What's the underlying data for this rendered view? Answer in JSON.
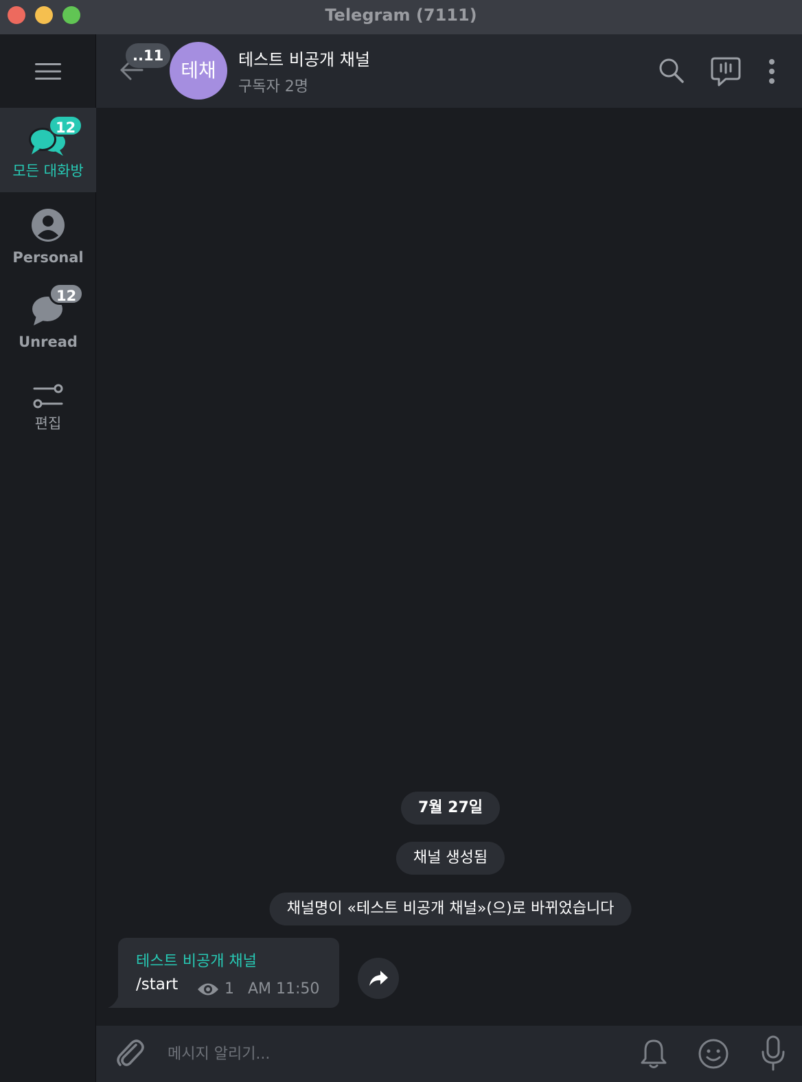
{
  "window": {
    "title": "Telegram (7111)"
  },
  "sidebar": {
    "menu_icon": "hamburger-icon",
    "folders": [
      {
        "label": "모든 대화방",
        "badge": "12",
        "icon": "chats-icon",
        "active": true
      },
      {
        "label": "Personal",
        "badge": "",
        "icon": "person-icon",
        "active": false
      },
      {
        "label": "Unread",
        "badge": "12",
        "icon": "chat-bubble-icon",
        "active": false
      },
      {
        "label": "편집",
        "badge": "",
        "icon": "sliders-icon",
        "active": false
      }
    ]
  },
  "header": {
    "back_badge": "..11",
    "avatar_text": "테채",
    "title": "테스트 비공개 채널",
    "subtitle": "구독자 2명",
    "icons": [
      "search-icon",
      "live-stream-icon",
      "more-vertical-icon"
    ]
  },
  "messages": {
    "date": "7월 27일",
    "service": [
      "채널 생성됨",
      "채널명이 «테스트 비공개 채널»(으)로 바뀌었습니다"
    ],
    "post": {
      "author": "테스트 비공개 채널",
      "text": "/start",
      "views": "1",
      "time": "AM 11:50"
    }
  },
  "composer": {
    "placeholder": "메시지 알리기..."
  },
  "colors": {
    "accent": "#27c9b4",
    "background": "#1a1c20",
    "panel": "#25282e",
    "bubble": "#2b2e34",
    "avatar": "#a58ee0"
  }
}
